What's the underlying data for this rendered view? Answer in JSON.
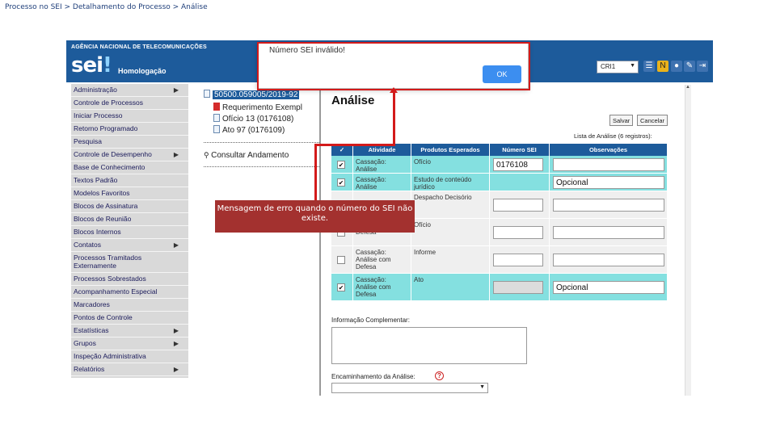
{
  "breadcrumb": "Processo no SEI > Detalhamento do Processo > Análise",
  "header": {
    "agency": "AGÊNCIA NACIONAL DE TELECOMUNICAÇÕES",
    "logo": "sei",
    "logo_dot": "!",
    "environment": "Homologação",
    "unit_select": "CRI1"
  },
  "sidebar": {
    "items": [
      {
        "label": "Administração",
        "chevron": true
      },
      {
        "label": "Controle de Processos",
        "chevron": false
      },
      {
        "label": "Iniciar Processo",
        "chevron": false
      },
      {
        "label": "Retorno Programado",
        "chevron": false
      },
      {
        "label": "Pesquisa",
        "chevron": false
      },
      {
        "label": "Controle de Desempenho",
        "chevron": true
      },
      {
        "label": "Base de Conhecimento",
        "chevron": false
      },
      {
        "label": "Textos Padrão",
        "chevron": false
      },
      {
        "label": "Modelos Favoritos",
        "chevron": false
      },
      {
        "label": "Blocos de Assinatura",
        "chevron": false
      },
      {
        "label": "Blocos de Reunião",
        "chevron": false
      },
      {
        "label": "Blocos Internos",
        "chevron": false
      },
      {
        "label": "Contatos",
        "chevron": true
      },
      {
        "label": "Processos Tramitados Externamente",
        "chevron": false
      },
      {
        "label": "Processos Sobrestados",
        "chevron": false
      },
      {
        "label": "Acompanhamento Especial",
        "chevron": false
      },
      {
        "label": "Marcadores",
        "chevron": false
      },
      {
        "label": "Pontos de Controle",
        "chevron": false
      },
      {
        "label": "Estatísticas",
        "chevron": true
      },
      {
        "label": "Grupos",
        "chevron": true
      },
      {
        "label": "Inspeção Administrativa",
        "chevron": false
      },
      {
        "label": "Relatórios",
        "chevron": true
      }
    ]
  },
  "tree": {
    "process_number": "50500.059005/2019-92",
    "documents": [
      {
        "label": "Requerimento Exempl",
        "type": "pdf"
      },
      {
        "label": "Ofício 13 (0176108)",
        "type": "doc"
      },
      {
        "label": "Ato 97 (0176109)",
        "type": "doc"
      }
    ],
    "consult": "Consultar Andamento"
  },
  "main": {
    "title": "Análise",
    "save_button": "Salvar",
    "cancel_button": "Cancelar",
    "list_caption": "Lista de Análise (6 registros):",
    "table": {
      "headers": [
        "✓",
        "Atividade",
        "Produtos Esperados",
        "Número SEI",
        "Observações"
      ],
      "rows": [
        {
          "checked": true,
          "activity": "Cassação: Análise",
          "product": "Ofício",
          "number": "0176108",
          "obs": "",
          "highlight": true,
          "number_grey": false
        },
        {
          "checked": true,
          "activity": "Cassação: Análise",
          "product": "Estudo de conteúdo jurídico",
          "number": "",
          "obs": "Opcional",
          "highlight": true,
          "number_grey": false
        },
        {
          "checked": false,
          "activity": "",
          "product": "Despacho Decisório",
          "number": "",
          "obs": "",
          "highlight": false,
          "number_grey": false
        },
        {
          "checked": false,
          "activity": "Análise com Defesa",
          "product": "Ofício",
          "number": "",
          "obs": "",
          "highlight": false,
          "number_grey": false
        },
        {
          "checked": false,
          "activity": "Cassação: Análise com Defesa",
          "product": "Informe",
          "number": "",
          "obs": "",
          "highlight": false,
          "number_grey": false
        },
        {
          "checked": true,
          "activity": "Cassação: Análise com Defesa",
          "product": "Ato",
          "number": "",
          "obs": "Opcional",
          "highlight": true,
          "number_grey": true
        }
      ]
    },
    "info_label": "Informação Complementar:",
    "enc_label": "Encaminhamento da Análise:"
  },
  "dialog": {
    "message": "Número SEI inválido!",
    "ok_button": "OK"
  },
  "callout": {
    "text": "Mensagem de erro quando o número do SEI não existe."
  },
  "colors": {
    "brand": "#1d5b9b",
    "highlight_row": "#84e0e0",
    "annotation_red": "#d31a1a",
    "callout_bg": "#a3312f",
    "ok_button": "#3c8ef0"
  }
}
